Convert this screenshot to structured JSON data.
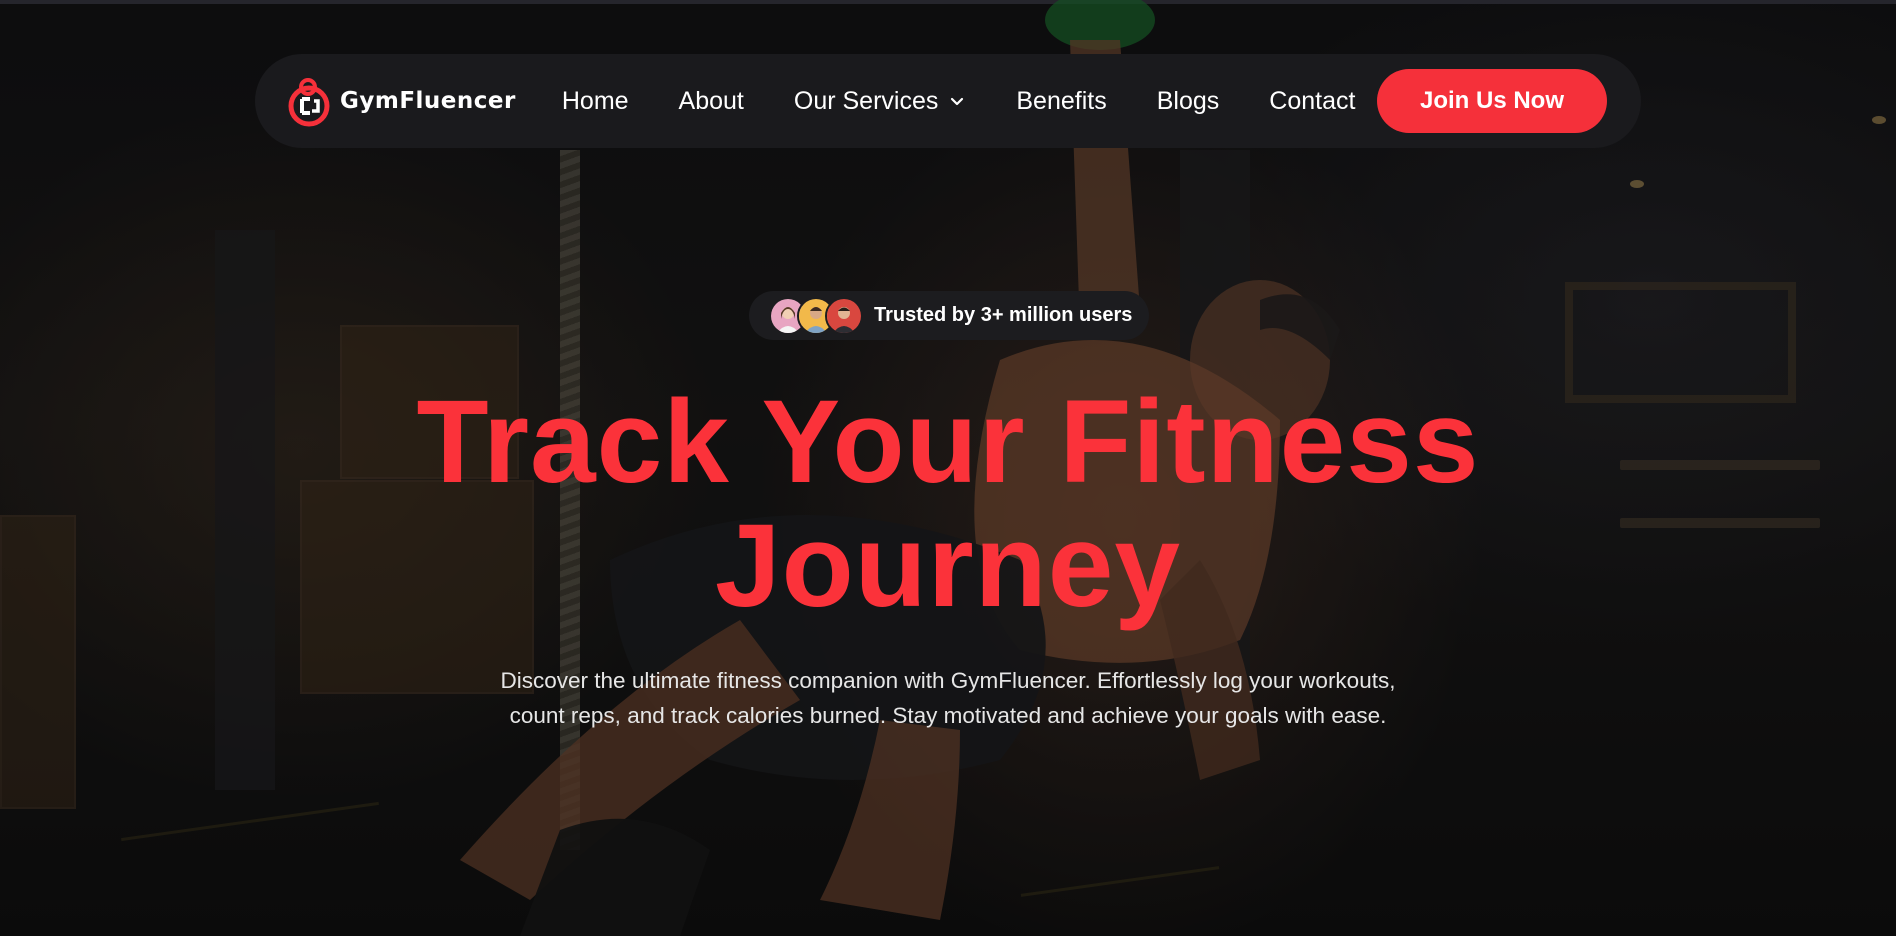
{
  "brand": {
    "name": "GymFluencer"
  },
  "nav": {
    "items": [
      {
        "label": "Home"
      },
      {
        "label": "About"
      },
      {
        "label": "Our Services",
        "icon": "chevron-down-icon"
      },
      {
        "label": "Benefits"
      },
      {
        "label": "Blogs"
      },
      {
        "label": "Contact"
      }
    ],
    "cta_label": "Join Us Now"
  },
  "hero": {
    "trusted_text": "Trusted by 3+ million users",
    "headline_line1": "Track Your Fitness",
    "headline_line2": "Journey",
    "subtext_line1": "Discover the ultimate fitness companion with GymFluencer. Effortlessly log your workouts,",
    "subtext_line2": "count reps, and track calories burned. Stay motivated and achieve your goals with ease."
  },
  "colors": {
    "accent": "#f5303a",
    "headline": "#fb323a",
    "nav_bg": "#1a1a1d",
    "text": "#ffffff"
  }
}
